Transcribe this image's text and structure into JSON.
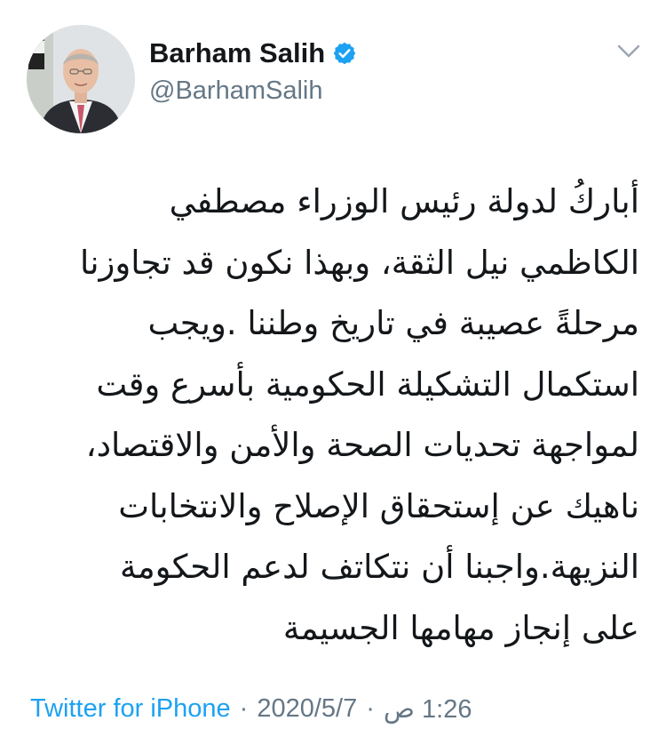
{
  "user": {
    "display_name": "Barham Salih",
    "handle": "@BarhamSalih",
    "verified": true,
    "avatar": "portrait-avatar"
  },
  "tweet": {
    "lines": [
      "أباركُ لدولة رئيس الوزراء مصطفي",
      "الكاظمي نيل الثقة، وبهذا نكون قد تجاوزنا",
      "مرحلةً عصيبة في تاريخ وطننا .ويجب",
      "استكمال التشكيلة الحكومية بأسرع وقت",
      "لمواجهة تحديات الصحة والأمن والاقتصاد،",
      "ناهيك عن إستحقاق الإصلاح والانتخابات",
      "النزيهة.واجبنا أن نتكاتف لدعم الحكومة",
      "على إنجاز مهامها الجسيمة"
    ]
  },
  "meta": {
    "time": "1:26 ص",
    "separator": "·",
    "date": "2020/5/7",
    "source": "Twitter for iPhone"
  },
  "colors": {
    "link": "#1da1f2",
    "secondary_text": "#657786",
    "verified_badge": "#1da1f2"
  },
  "icons": {
    "menu": "chevron-down-icon",
    "verified": "verified-badge-icon"
  }
}
